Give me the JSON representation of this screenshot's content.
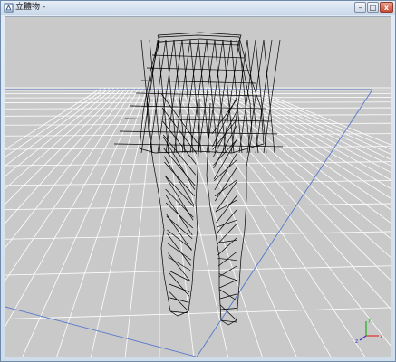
{
  "window": {
    "title": "立體物 - ",
    "controls": {
      "minimize": "–",
      "maximize": "□",
      "close": "x"
    }
  },
  "viewport": {
    "background": "#c9c9c9",
    "grid_color": "#ffffff",
    "axis_line_color": "#5577cc",
    "mesh_color": "#000000",
    "axes_gizmo": [
      "x",
      "y",
      "z"
    ]
  }
}
